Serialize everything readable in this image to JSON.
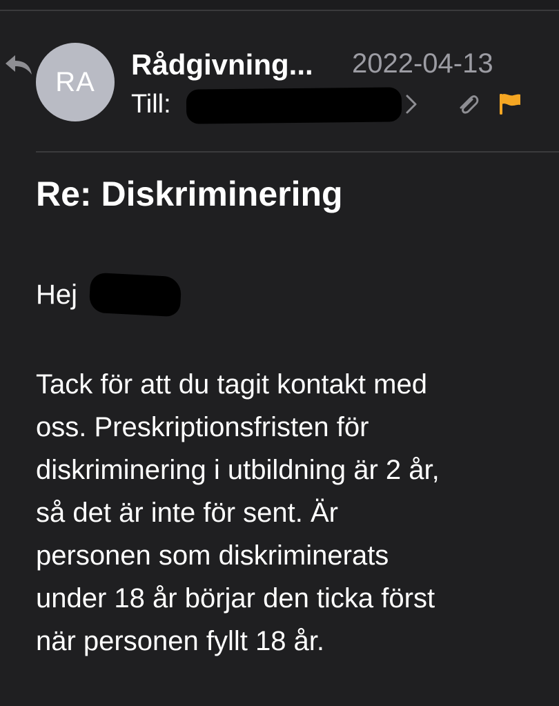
{
  "header": {
    "sender": "Rådgivning...",
    "date": "2022-04-13",
    "to_label": "Till:",
    "avatar_initials": "RA"
  },
  "icons": {
    "reply": "reply-icon",
    "chevron": "chevron-right-icon",
    "attachment": "paperclip-icon",
    "flag": "flag-icon",
    "flag_color": "#f5a623"
  },
  "message": {
    "subject": "Re: Diskriminering",
    "greeting": "Hej",
    "body_lines": [
      "Tack för att du tagit kontakt med",
      "oss. Preskriptionsfristen för",
      "diskriminering i utbildning är 2 år,",
      "så det är inte för sent. Är",
      "personen som diskriminerats",
      "under 18 år börjar den ticka först",
      "när personen fyllt 18 år."
    ]
  }
}
